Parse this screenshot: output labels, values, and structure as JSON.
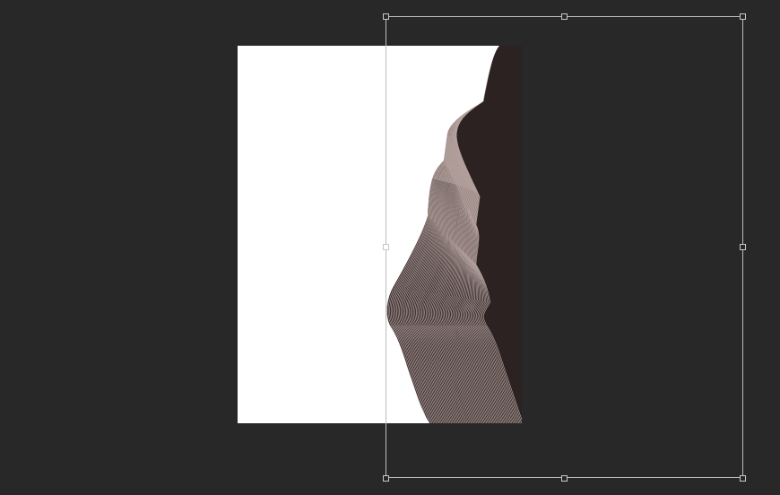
{
  "canvas": {
    "background_color": "#282828"
  },
  "document": {
    "page_color": "#ffffff",
    "artwork": "abstract-wavy-line-sculpture",
    "artwork_colors": {
      "shape": "#2c2222",
      "lines": "#cbb7b2"
    }
  },
  "transform_box": {
    "stroke_color": "#bdbdbd",
    "handles": [
      "top-left",
      "top-middle",
      "top-right",
      "middle-left",
      "middle-right",
      "bottom-left",
      "bottom-middle",
      "bottom-right"
    ]
  }
}
